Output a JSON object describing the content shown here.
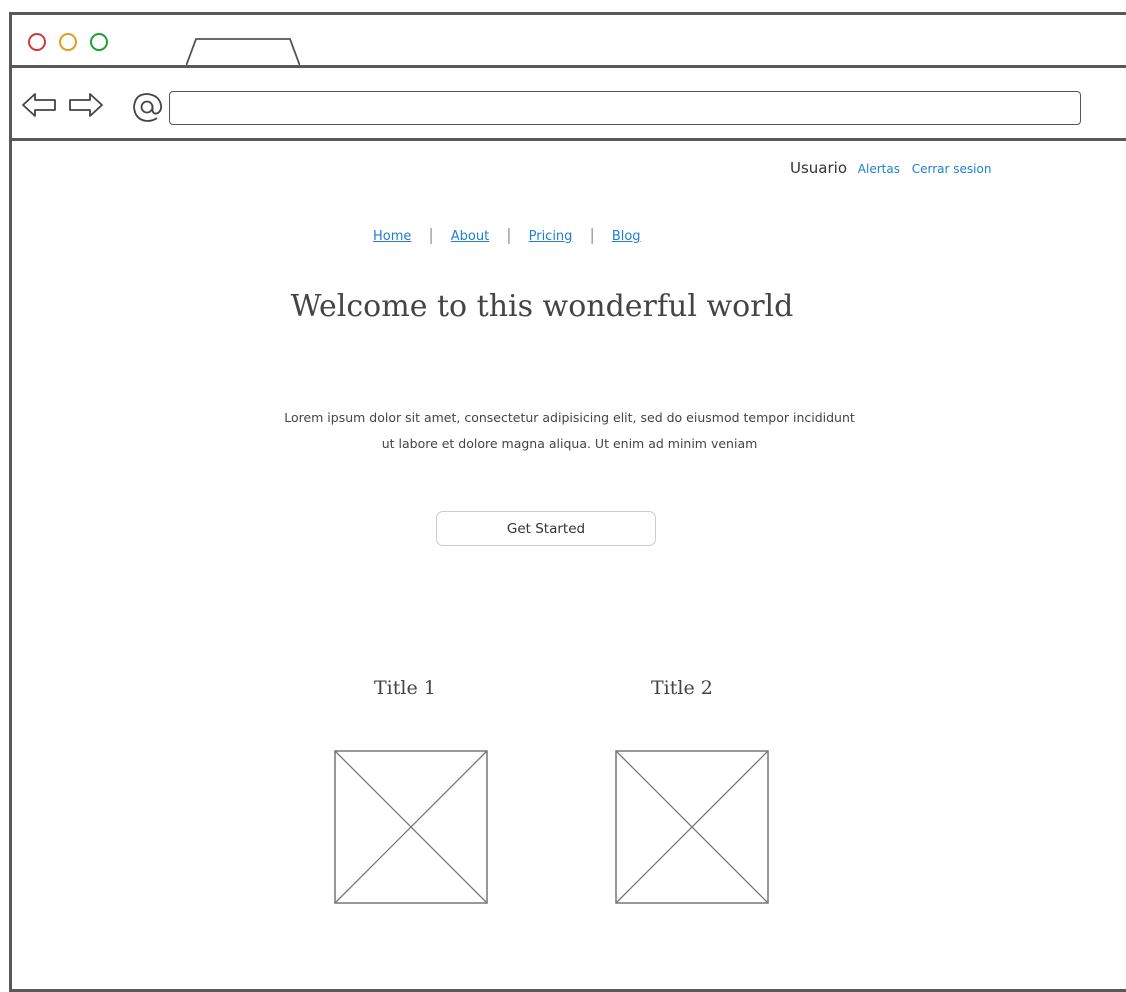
{
  "header": {
    "user_label": "Usuario",
    "links": [
      "Alertas",
      "Cerrar sesion"
    ]
  },
  "nav": {
    "items": [
      "Home",
      "About",
      "Pricing",
      "Blog"
    ]
  },
  "hero": {
    "title": "Welcome to this wonderful world",
    "body": "Lorem ipsum dolor sit amet, consectetur adipisicing elit, sed do eiusmod tempor incididunt ut labore et dolore magna aliqua. Ut enim ad minim veniam",
    "cta_label": "Get Started"
  },
  "cards": [
    {
      "title": "Title 1"
    },
    {
      "title": "Title 2"
    }
  ],
  "colors": {
    "link": "#1f7fd0",
    "frame": "#595959",
    "dot_red": "#cc3b3b",
    "dot_orange": "#e39a1e",
    "dot_green": "#1e9e32"
  }
}
